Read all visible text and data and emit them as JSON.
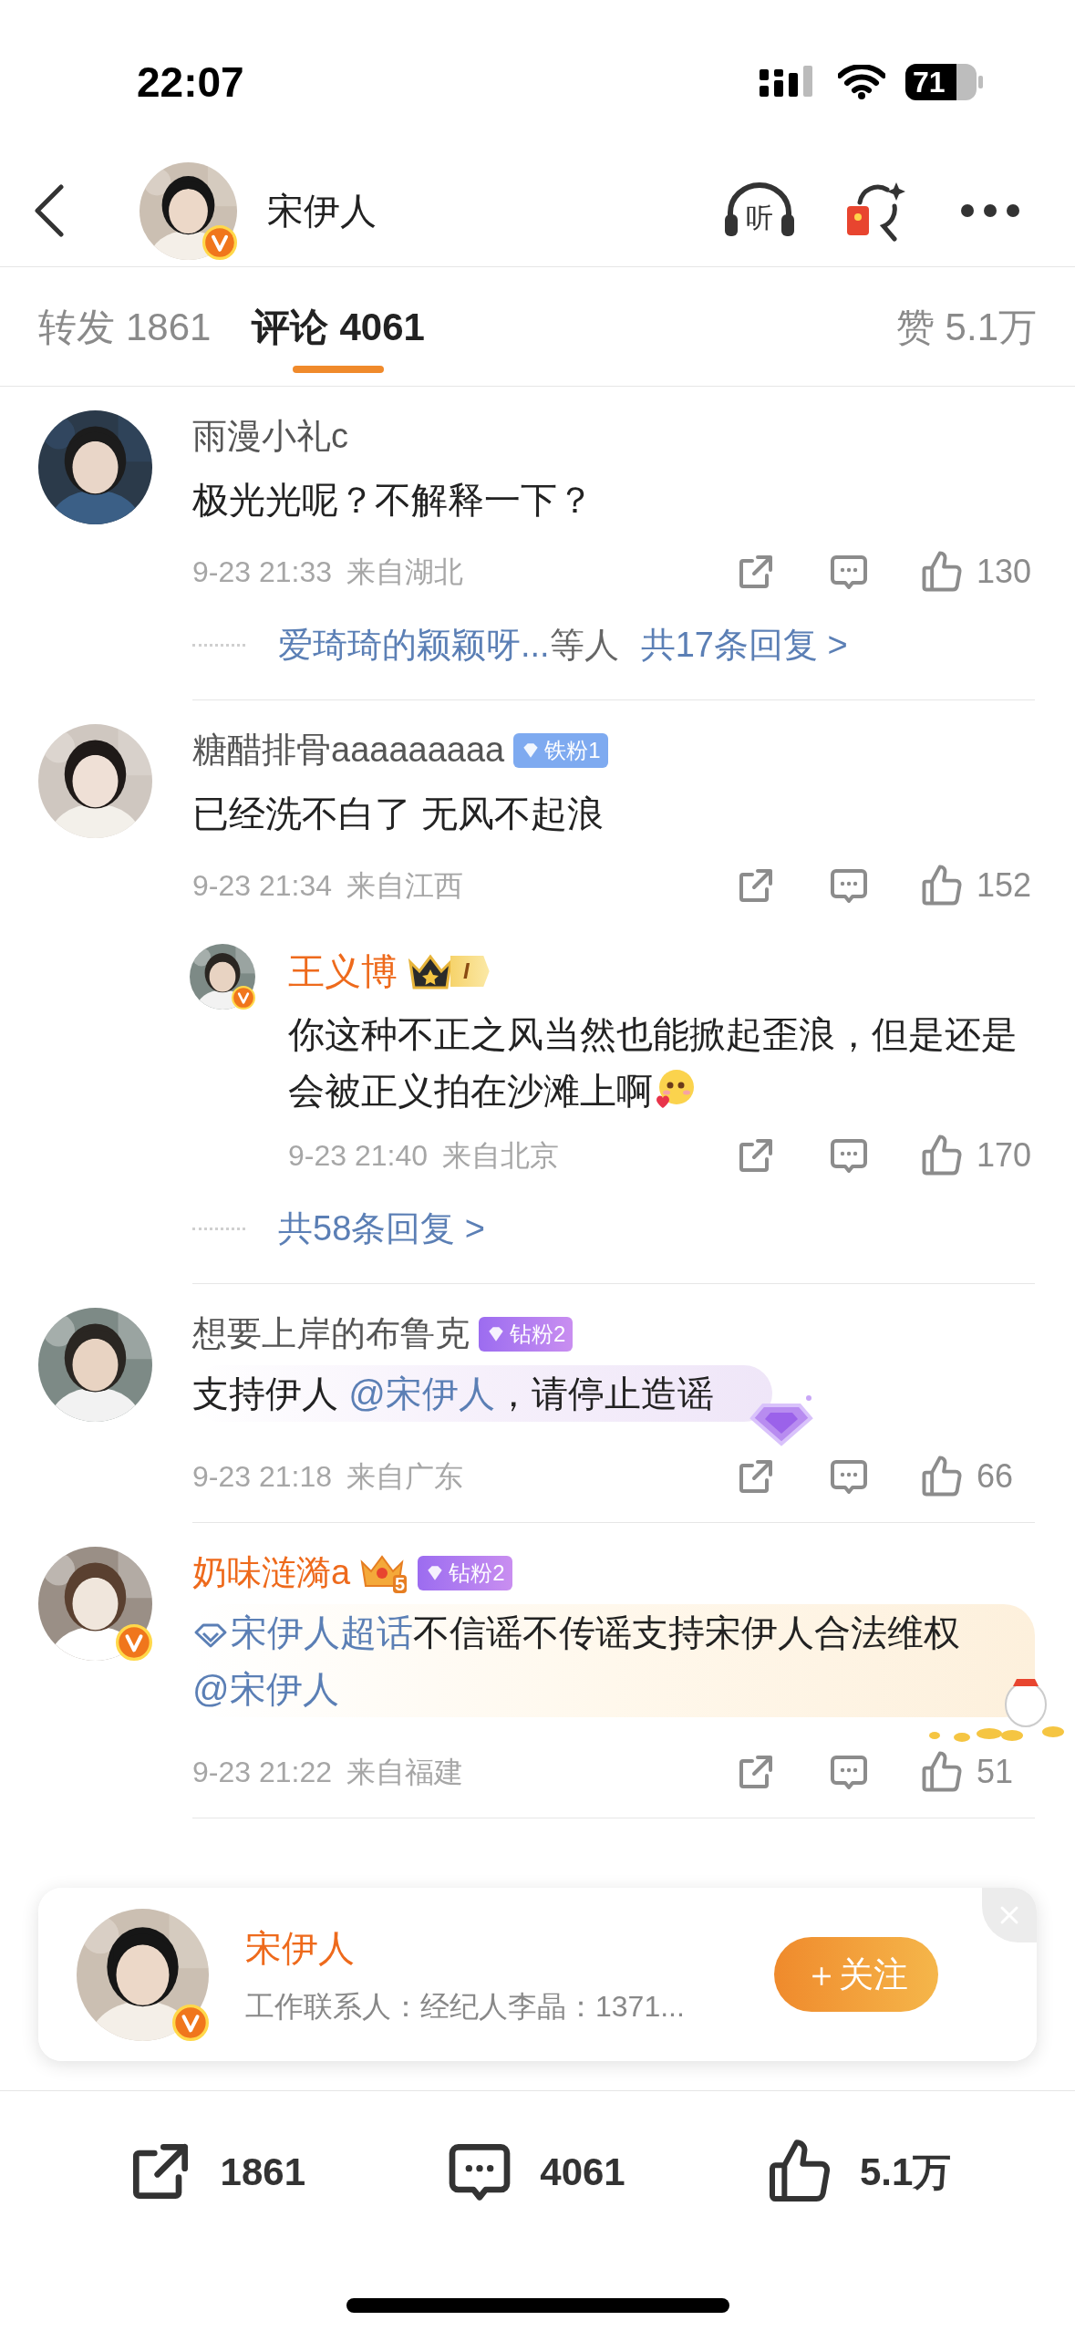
{
  "status_bar": {
    "time": "22:07",
    "battery": "71"
  },
  "nav": {
    "name": "宋伊人",
    "verified": true,
    "listen_label": "听"
  },
  "tabs": [
    {
      "label": "转发",
      "count": "1861",
      "selected": false
    },
    {
      "label": "评论",
      "count": "4061",
      "selected": true
    },
    {
      "label": "赞",
      "count": "5.1万",
      "selected": false
    }
  ],
  "comments": [
    {
      "kind": "plain",
      "name": "雨漫小礼c",
      "vip": false,
      "verified": false,
      "content": [
        {
          "kind": "plain",
          "text": "极光光呢？不解释一下？"
        }
      ],
      "time": "9-23 21:33",
      "location": "来自湖北",
      "likes": "130",
      "replies": {
        "names": "爱琦琦的颖颖呀...",
        "suffix": "等人",
        "count_text": "共17条回复 >"
      }
    },
    {
      "kind": "plain",
      "name": "糖醋排骨aaaaaaaaa",
      "vip": false,
      "verified": false,
      "badges": [
        {
          "kind": "iron_fan",
          "label": "铁粉1"
        }
      ],
      "content": [
        {
          "kind": "plain",
          "text": "已经洗不白了 无风不起浪"
        }
      ],
      "time": "9-23 21:34",
      "location": "来自江西",
      "likes": "152",
      "sub_replies": [
        {
          "name": "王义博",
          "vip": true,
          "verified": true,
          "badges": [
            {
              "kind": "crown",
              "label": "I"
            }
          ],
          "content": [
            {
              "kind": "plain",
              "text": "你这种不正之风当然也能掀起歪浪，但是还是会被正义拍在沙滩上啊"
            },
            {
              "kind": "emoji"
            }
          ],
          "time": "9-23 21:40",
          "location": "来自北京",
          "likes": "170"
        }
      ],
      "replies": {
        "count_text": "共58条回复 >"
      }
    },
    {
      "kind": "purple_bubble",
      "name": "想要上岸的布鲁克",
      "vip": false,
      "verified": false,
      "badges": [
        {
          "kind": "diamond_fan",
          "label": "钻粉2"
        }
      ],
      "content": [
        {
          "kind": "plain",
          "text": "支持伊人 "
        },
        {
          "kind": "mention",
          "text": "@宋伊人"
        },
        {
          "kind": "plain",
          "text": "，请停止造谣"
        }
      ],
      "time": "9-23 21:18",
      "location": "来自广东",
      "likes": "66"
    },
    {
      "kind": "gold_bubble",
      "name": "奶味涟漪a",
      "vip": true,
      "verified": true,
      "badges": [
        {
          "kind": "crown_level",
          "label": "5"
        },
        {
          "kind": "diamond_fan",
          "label": "钻粉2"
        }
      ],
      "content": [
        {
          "kind": "topic",
          "text": "宋伊人超话"
        },
        {
          "kind": "plain",
          "text": "不信谣不传谣支持宋伊人合法维权"
        },
        {
          "kind": "mention",
          "text": "@宋伊人"
        }
      ],
      "time": "9-23 21:22",
      "location": "来自福建",
      "likes": "51"
    }
  ],
  "follow_card": {
    "name": "宋伊人",
    "verified": true,
    "description": "工作联系人：经纪人李晶：1371...",
    "button": "＋关注"
  },
  "bottom_bar": [
    {
      "kind": "share",
      "label": "1861"
    },
    {
      "kind": "comment",
      "label": "4061"
    },
    {
      "kind": "like",
      "label": "5.1万"
    }
  ]
}
